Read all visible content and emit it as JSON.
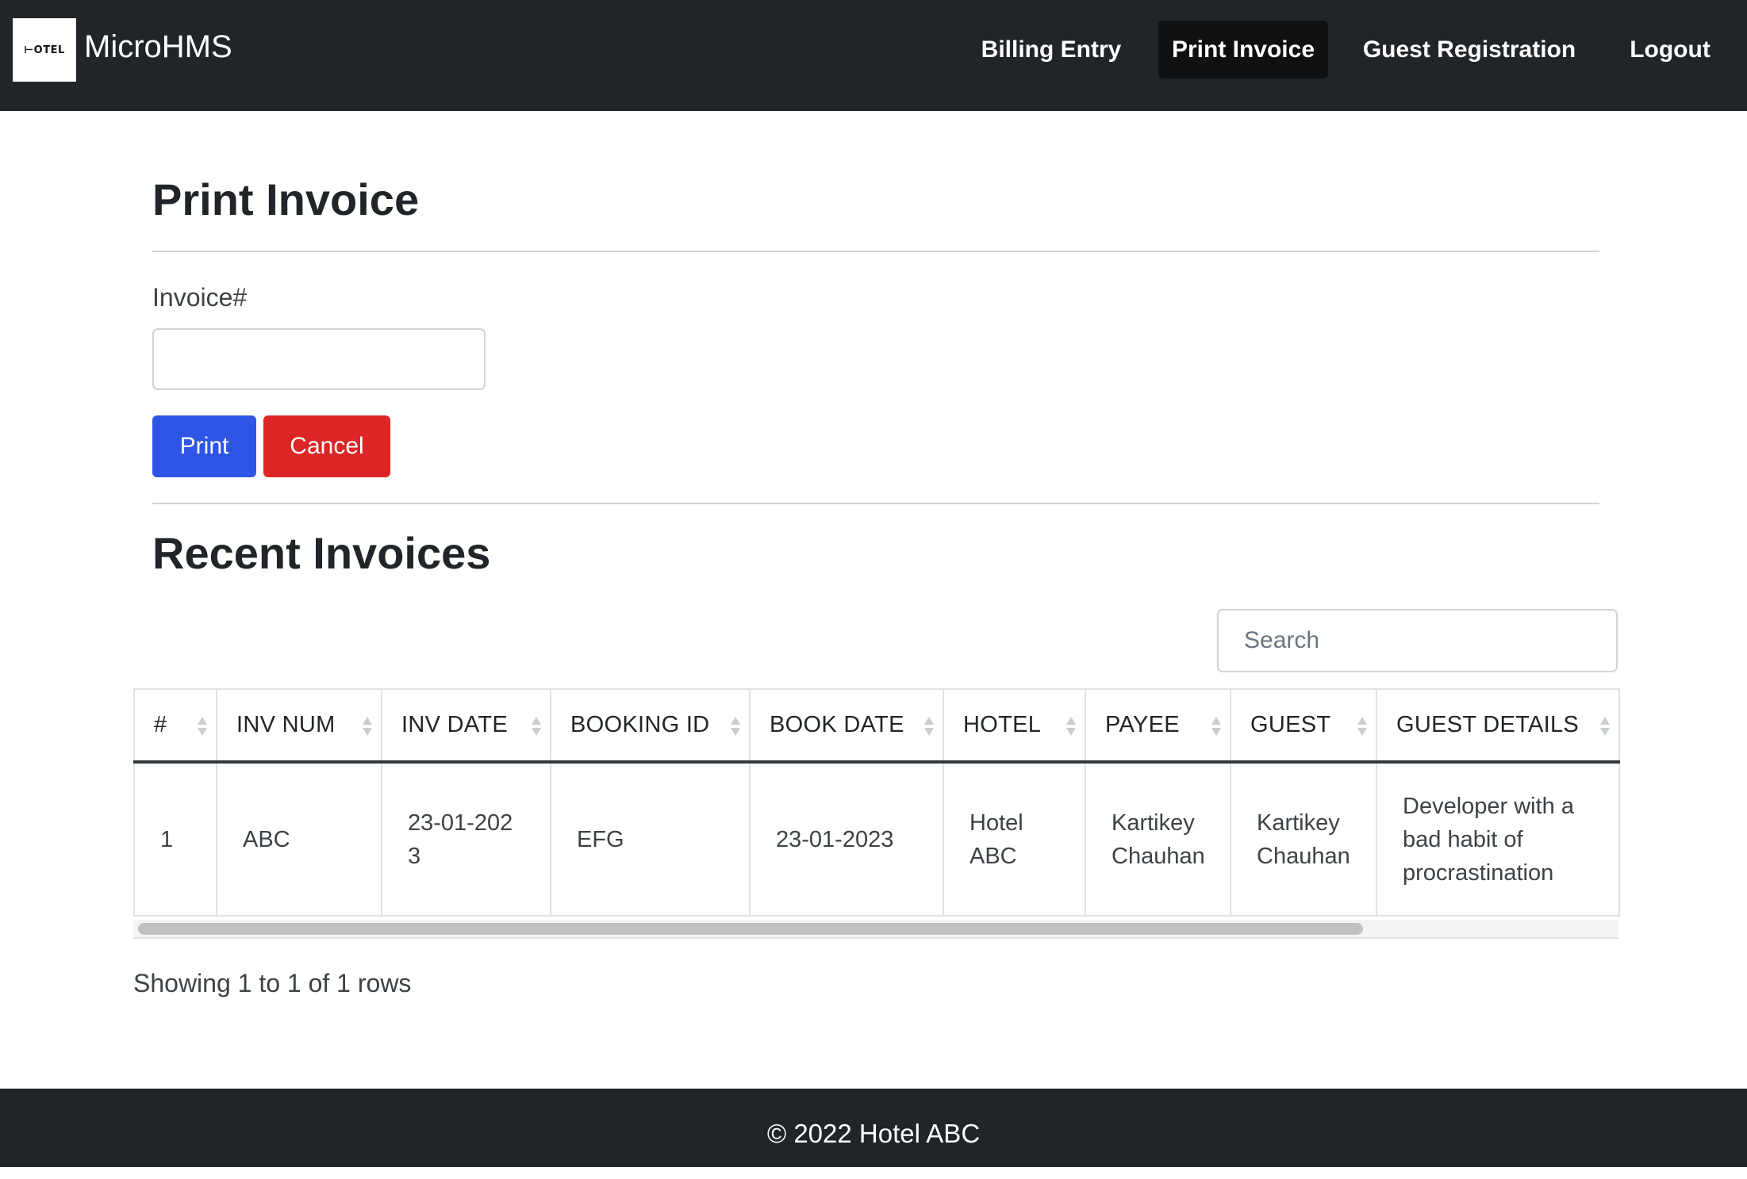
{
  "navbar": {
    "logo_text": "⊢OTEL",
    "brand": "MicroHMS",
    "links": [
      {
        "label": "Billing Entry",
        "active": false
      },
      {
        "label": "Print Invoice",
        "active": true
      },
      {
        "label": "Guest Registration",
        "active": false
      },
      {
        "label": "Logout",
        "active": false
      }
    ]
  },
  "main": {
    "title": "Print Invoice",
    "invoice_label": "Invoice#",
    "invoice_value": "",
    "print_label": "Print",
    "cancel_label": "Cancel",
    "recent_title": "Recent Invoices",
    "search_placeholder": "Search"
  },
  "table": {
    "columns": [
      "#",
      "INV NUM",
      "INV DATE",
      "BOOKING ID",
      "BOOK DATE",
      "HOTEL",
      "PAYEE",
      "GUEST",
      "GUEST DETAILS"
    ],
    "rows": [
      [
        "1",
        "ABC",
        "23-01-2023",
        "EFG",
        "23-01-2023",
        "Hotel ABC",
        "Kartikey Chauhan",
        "Kartikey Chauhan",
        "Developer with a bad habit of procrastination"
      ]
    ],
    "pagination": "Showing 1 to 1 of 1 rows"
  },
  "footer": {
    "text": "© 2022 Hotel ABC"
  },
  "colors": {
    "navbar_bg": "#212529",
    "primary": "#2f55e4",
    "danger": "#dc2626"
  }
}
